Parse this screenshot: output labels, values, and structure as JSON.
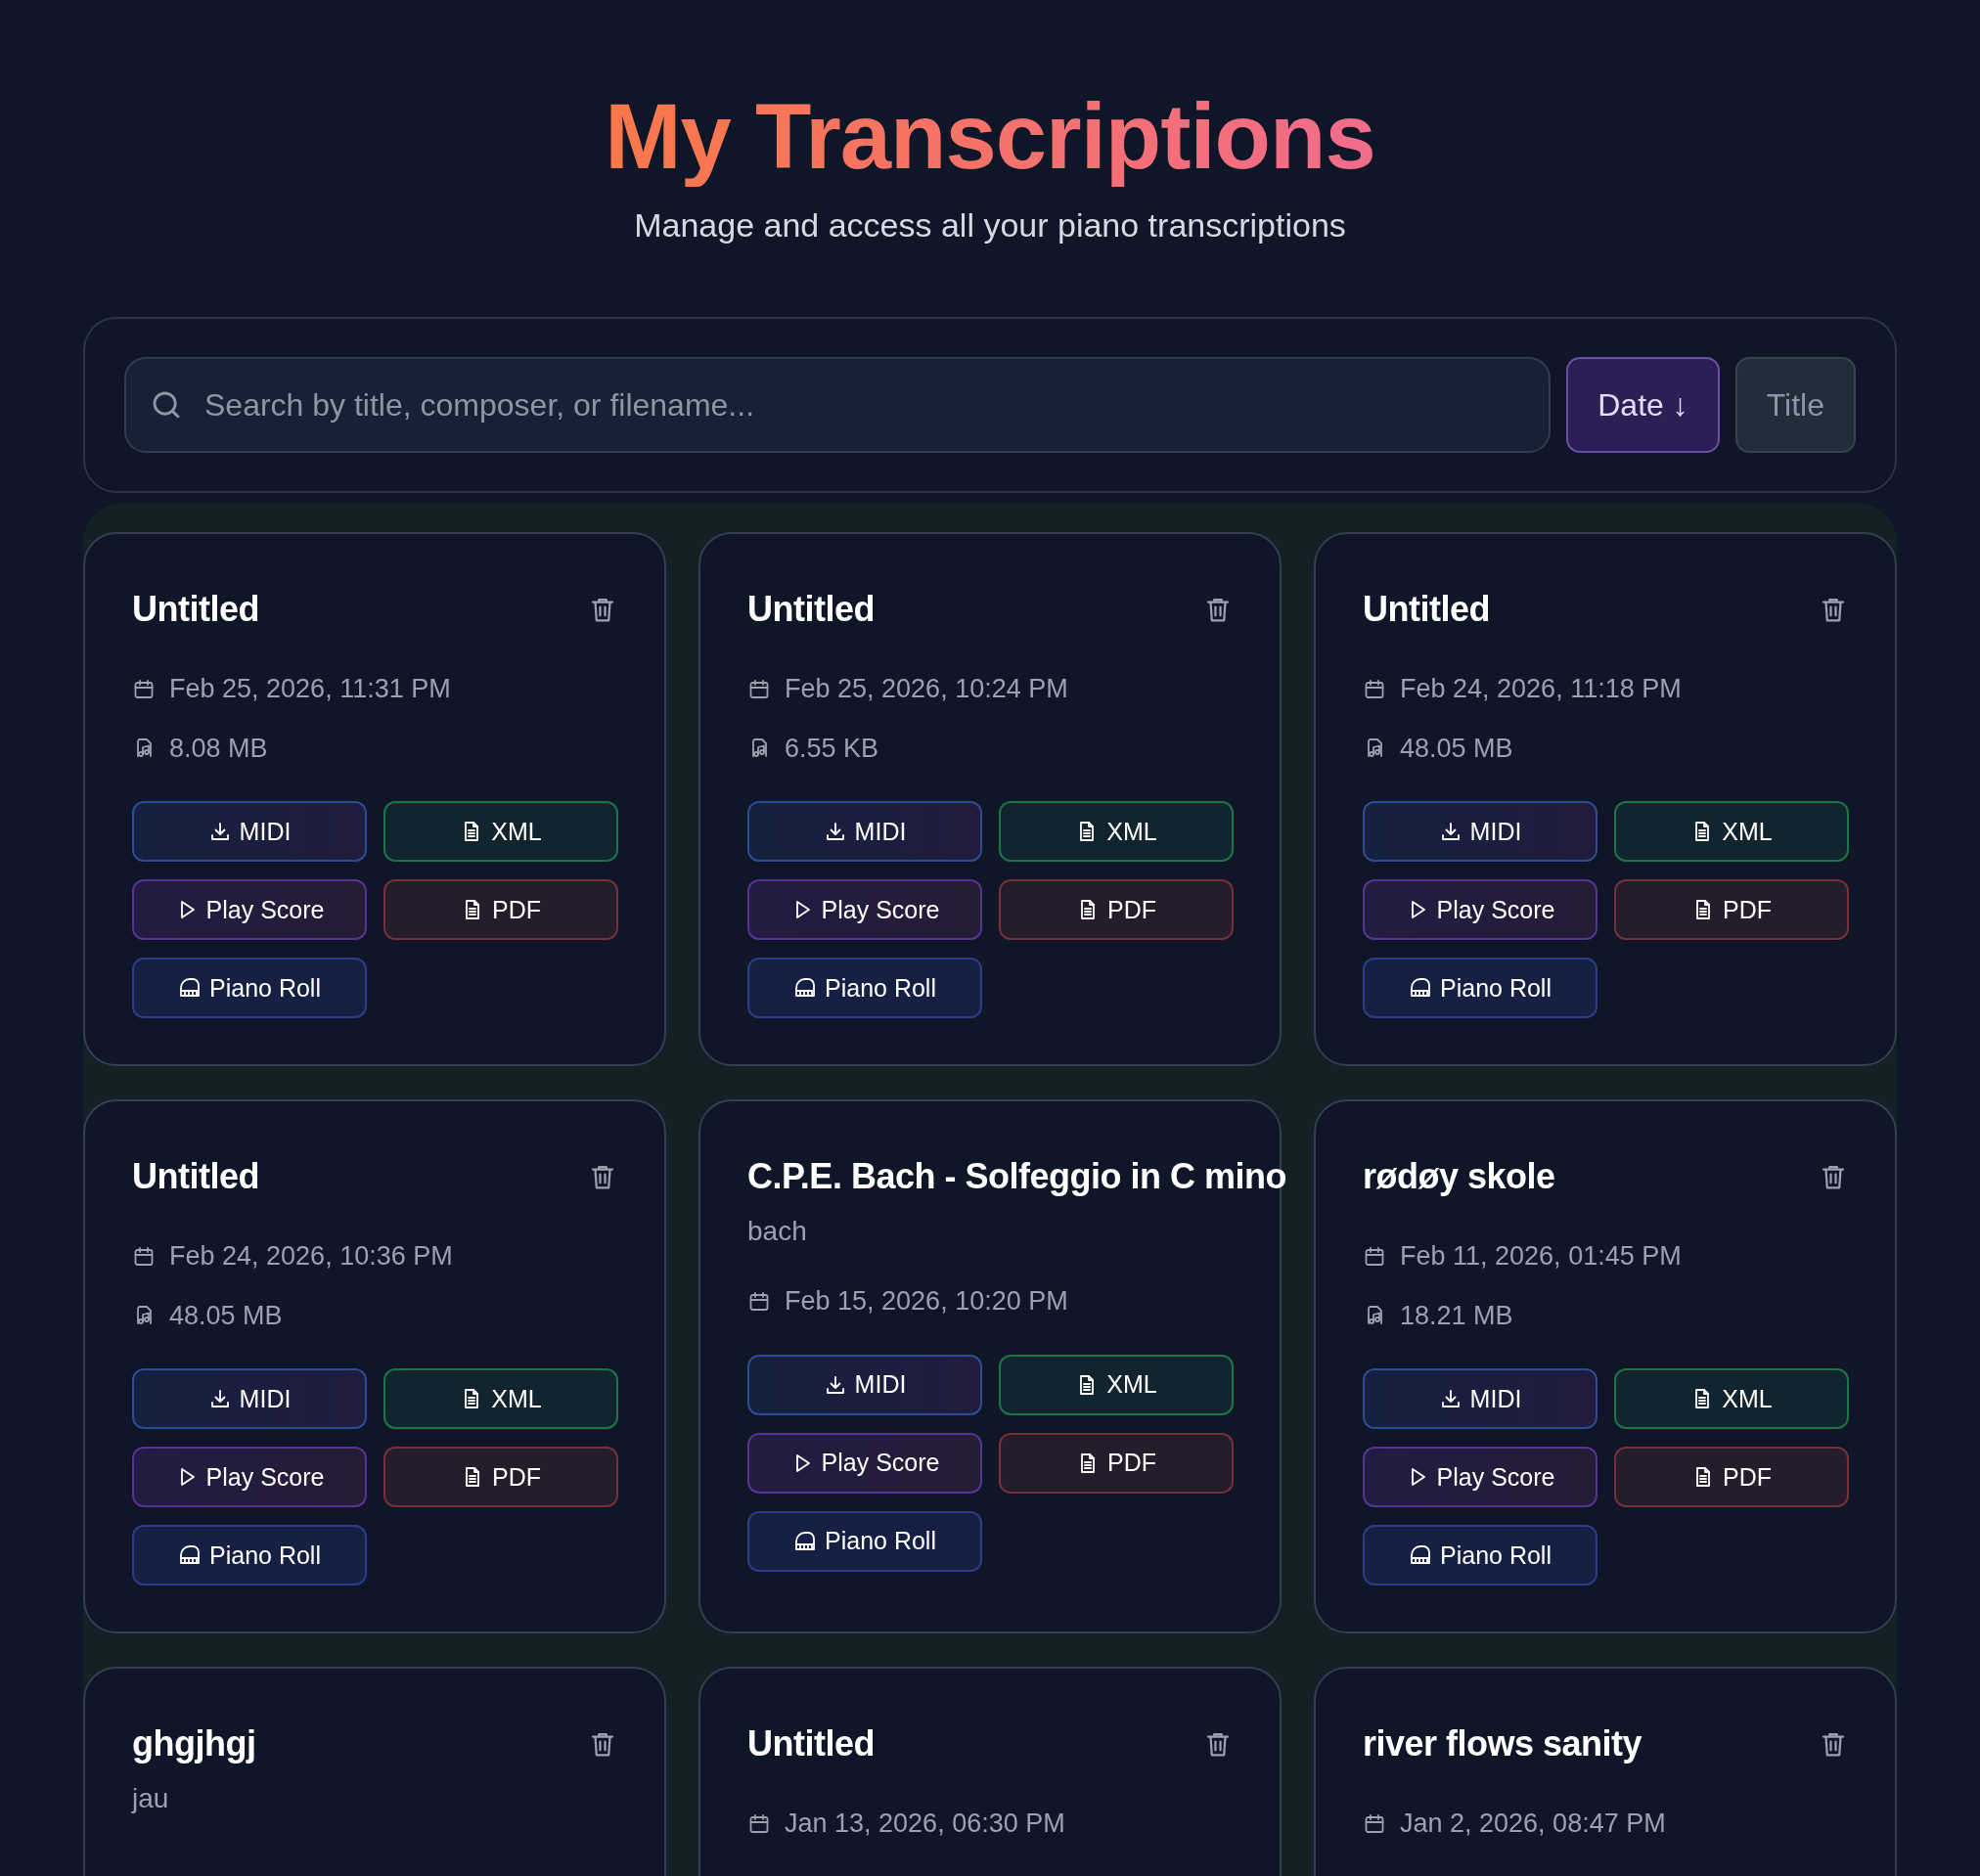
{
  "header": {
    "title": "My Transcriptions",
    "subtitle": "Manage and access all your piano transcriptions"
  },
  "search": {
    "placeholder": "Search by title, composer, or filename..."
  },
  "sort_buttons": [
    {
      "label": "Date ↓",
      "selected": true
    },
    {
      "label": "Title",
      "selected": false
    }
  ],
  "cards": [
    {
      "title": "Untitled",
      "delete_visible": true,
      "date": "Feb 25, 2026, 11:31 PM",
      "size": "8.08 MB",
      "buttons": [
        {
          "kind": "midi",
          "label": "MIDI"
        },
        {
          "kind": "xml",
          "label": "XML"
        },
        {
          "kind": "play",
          "label": "Play Score"
        },
        {
          "kind": "pdf",
          "label": "PDF"
        },
        {
          "kind": "roll",
          "label": "Piano Roll"
        }
      ]
    },
    {
      "title": "Untitled",
      "delete_visible": true,
      "date": "Feb 25, 2026, 10:24 PM",
      "size": "6.55 KB",
      "buttons": [
        {
          "kind": "midi",
          "label": "MIDI"
        },
        {
          "kind": "xml",
          "label": "XML"
        },
        {
          "kind": "play",
          "label": "Play Score"
        },
        {
          "kind": "pdf",
          "label": "PDF"
        },
        {
          "kind": "roll",
          "label": "Piano Roll"
        }
      ]
    },
    {
      "title": "Untitled",
      "delete_visible": true,
      "date": "Feb 24, 2026, 11:18 PM",
      "size": "48.05 MB",
      "buttons": [
        {
          "kind": "midi",
          "label": "MIDI"
        },
        {
          "kind": "xml",
          "label": "XML"
        },
        {
          "kind": "play",
          "label": "Play Score"
        },
        {
          "kind": "pdf",
          "label": "PDF"
        },
        {
          "kind": "roll",
          "label": "Piano Roll"
        }
      ]
    },
    {
      "title": "Untitled",
      "delete_visible": true,
      "date": "Feb 24, 2026, 10:36 PM",
      "size": "48.05 MB",
      "buttons": [
        {
          "kind": "midi",
          "label": "MIDI"
        },
        {
          "kind": "xml",
          "label": "XML"
        },
        {
          "kind": "play",
          "label": "Play Score"
        },
        {
          "kind": "pdf",
          "label": "PDF"
        },
        {
          "kind": "roll",
          "label": "Piano Roll"
        }
      ]
    },
    {
      "title": "C.P.E. Bach - Solfeggio in C mino",
      "delete_visible": false,
      "composer": "bach",
      "date": "Feb 15, 2026, 10:20 PM",
      "buttons": [
        {
          "kind": "midi",
          "label": "MIDI"
        },
        {
          "kind": "xml",
          "label": "XML"
        },
        {
          "kind": "play",
          "label": "Play Score"
        },
        {
          "kind": "pdf",
          "label": "PDF"
        },
        {
          "kind": "roll",
          "label": "Piano Roll"
        }
      ]
    },
    {
      "title": "rødøy skole",
      "delete_visible": true,
      "date": "Feb 11, 2026, 01:45 PM",
      "size": "18.21 MB",
      "buttons": [
        {
          "kind": "midi",
          "label": "MIDI"
        },
        {
          "kind": "xml",
          "label": "XML"
        },
        {
          "kind": "play",
          "label": "Play Score"
        },
        {
          "kind": "pdf",
          "label": "PDF"
        },
        {
          "kind": "roll",
          "label": "Piano Roll"
        }
      ]
    },
    {
      "title": "ghgjhgj",
      "delete_visible": true,
      "composer": "jau"
    },
    {
      "title": "Untitled",
      "delete_visible": true,
      "date": "Jan 13, 2026, 06:30 PM"
    },
    {
      "title": "river flows sanity",
      "delete_visible": true,
      "date": "Jan 2, 2026, 08:47 PM"
    }
  ]
}
